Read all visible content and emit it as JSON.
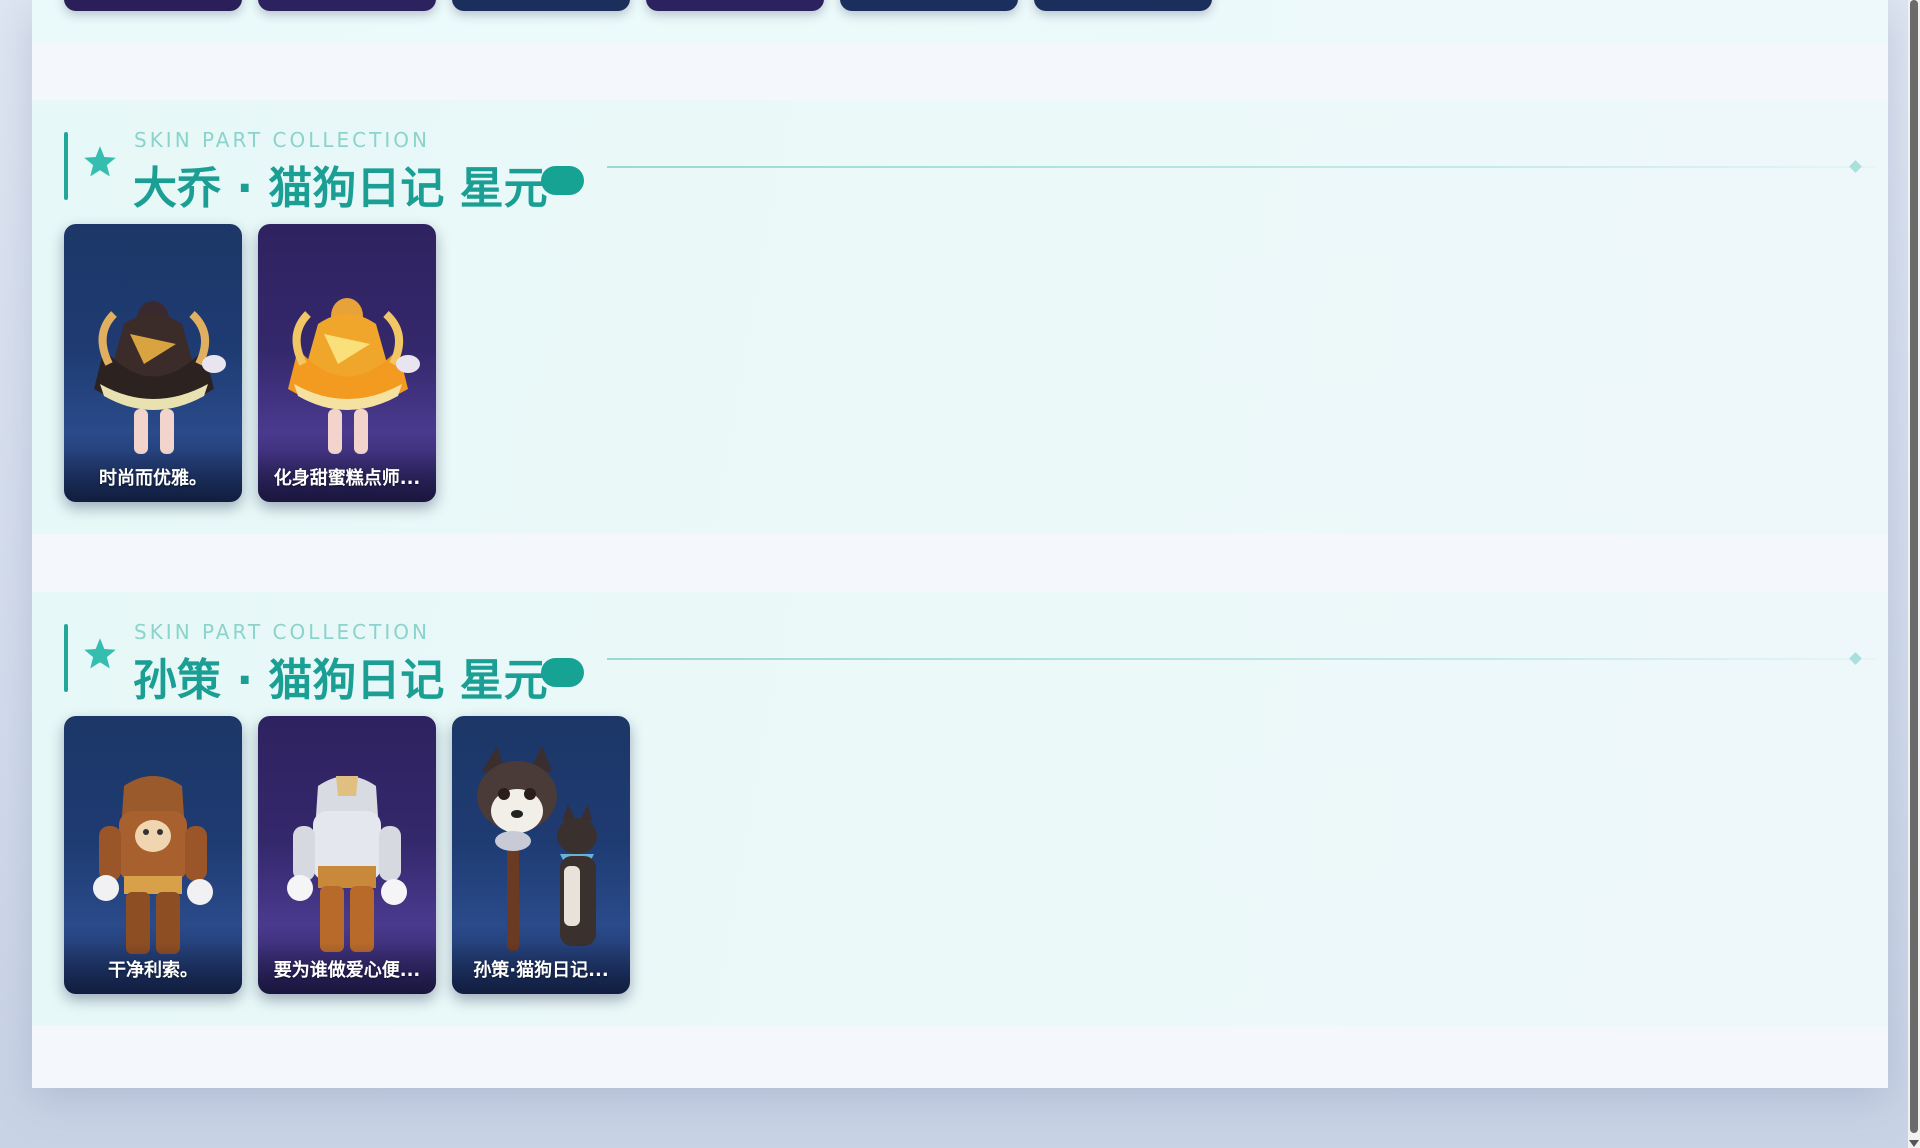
{
  "sections": [
    {
      "kicker": "SKIN PART COLLECTION",
      "title": "大乔 · 猫狗日记 星元",
      "items": [
        {
          "label": "时尚而优雅。"
        },
        {
          "label": "化身甜蜜糕点师..."
        }
      ]
    },
    {
      "kicker": "SKIN PART COLLECTION",
      "title": "孙策 · 猫狗日记 星元",
      "items": [
        {
          "label": "干净利索。"
        },
        {
          "label": "要为谁做爱心便..."
        },
        {
          "label": "孙策·猫狗日记..."
        }
      ]
    }
  ],
  "colors": {
    "accent": "#1b9f94",
    "pill": "#16a394",
    "card_blue": "#1e3b72",
    "card_purple": "#34286c"
  },
  "icons": {
    "section_marker": "star-icon",
    "section_badge": "pill-badge"
  }
}
